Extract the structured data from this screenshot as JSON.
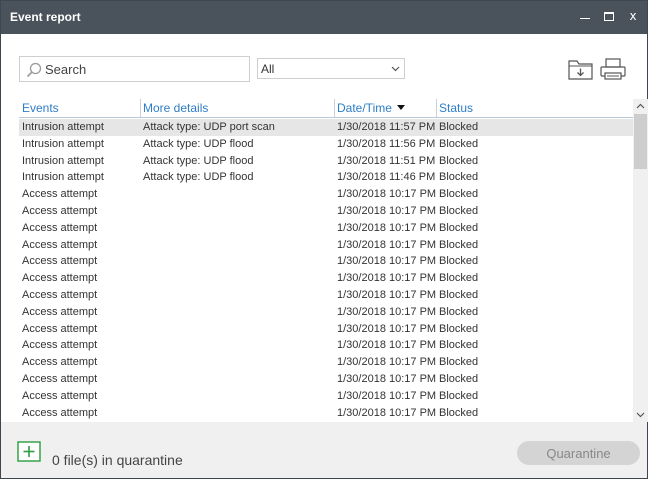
{
  "window": {
    "title": "Event report",
    "controls": {
      "minimize": "minimize-icon",
      "maximize": "maximize-icon",
      "close": "x"
    }
  },
  "toolbar": {
    "search_placeholder": "Search",
    "search_value": "",
    "filter_value": "All",
    "export_icon": "folder-download-icon",
    "print_icon": "printer-icon"
  },
  "table": {
    "columns": [
      "Events",
      "More details",
      "Date/Time",
      "Status"
    ],
    "sorted_column": "Date/Time",
    "sort_direction": "descending",
    "selected_row": 0,
    "rows": [
      [
        "Intrusion attempt",
        "Attack type: UDP port scan",
        "1/30/2018 11:57 PM",
        "Blocked"
      ],
      [
        "Intrusion attempt",
        "Attack type: UDP flood",
        "1/30/2018 11:56 PM",
        "Blocked"
      ],
      [
        "Intrusion attempt",
        "Attack type: UDP flood",
        "1/30/2018 11:51 PM",
        "Blocked"
      ],
      [
        "Intrusion attempt",
        "Attack type: UDP flood",
        "1/30/2018 11:46 PM",
        "Blocked"
      ],
      [
        "Access attempt",
        "",
        "1/30/2018 10:17 PM",
        "Blocked"
      ],
      [
        "Access attempt",
        "",
        "1/30/2018 10:17 PM",
        "Blocked"
      ],
      [
        "Access attempt",
        "",
        "1/30/2018 10:17 PM",
        "Blocked"
      ],
      [
        "Access attempt",
        "",
        "1/30/2018 10:17 PM",
        "Blocked"
      ],
      [
        "Access attempt",
        "",
        "1/30/2018 10:17 PM",
        "Blocked"
      ],
      [
        "Access attempt",
        "",
        "1/30/2018 10:17 PM",
        "Blocked"
      ],
      [
        "Access attempt",
        "",
        "1/30/2018 10:17 PM",
        "Blocked"
      ],
      [
        "Access attempt",
        "",
        "1/30/2018 10:17 PM",
        "Blocked"
      ],
      [
        "Access attempt",
        "",
        "1/30/2018 10:17 PM",
        "Blocked"
      ],
      [
        "Access attempt",
        "",
        "1/30/2018 10:17 PM",
        "Blocked"
      ],
      [
        "Access attempt",
        "",
        "1/30/2018 10:17 PM",
        "Blocked"
      ],
      [
        "Access attempt",
        "",
        "1/30/2018 10:17 PM",
        "Blocked"
      ],
      [
        "Access attempt",
        "",
        "1/30/2018 10:17 PM",
        "Blocked"
      ],
      [
        "Access attempt",
        "",
        "1/30/2018 10:17 PM",
        "Blocked"
      ]
    ]
  },
  "footer": {
    "add_icon": "plus-icon",
    "quarantine_count": "0 file(s) in quarantine",
    "quarantine_button": "Quarantine"
  },
  "colors": {
    "titlebar": "#4a535b",
    "header_text": "#2e7dc6",
    "selected_row": "#e6e6e6",
    "add_icon": "#2a9d3f",
    "footer_bg": "#f0f0f0"
  }
}
